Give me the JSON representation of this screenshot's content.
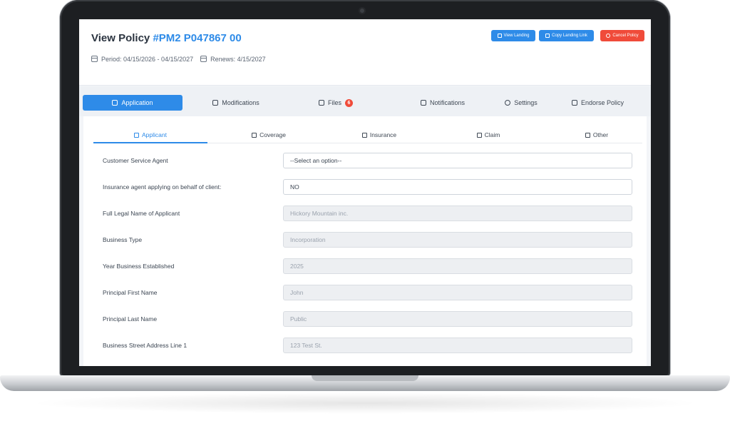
{
  "header": {
    "title_prefix": "View Policy ",
    "policy_number": "#PM2 P047867 00",
    "period": "Period: 04/15/2026 - 04/15/2027",
    "renews": "Renews: 4/15/2027",
    "buttons": {
      "view_landing": "View Landing",
      "copy_landing_link": "Copy Landing Link",
      "cancel_policy": "Cancel Policy"
    }
  },
  "main_tabs": [
    {
      "label": "Application",
      "icon": "document-icon",
      "active": true
    },
    {
      "label": "Modifications",
      "icon": "layers-icon"
    },
    {
      "label": "Files",
      "icon": "folder-icon",
      "badge": "6"
    },
    {
      "label": "Notifications",
      "icon": "external-link-icon"
    },
    {
      "label": "Settings",
      "icon": "gear-icon"
    },
    {
      "label": "Endorse Policy",
      "icon": "folder-plus-icon"
    }
  ],
  "sub_tabs": [
    {
      "label": "Applicant",
      "icon": "list-icon",
      "active": true
    },
    {
      "label": "Coverage",
      "icon": "book-icon"
    },
    {
      "label": "Insurance",
      "icon": "table-icon"
    },
    {
      "label": "Claim",
      "icon": "download-icon"
    },
    {
      "label": "Other",
      "icon": "box-icon"
    }
  ],
  "form": [
    {
      "label": "Customer Service Agent",
      "value": "--Select an option--",
      "readonly": false
    },
    {
      "label": "Insurance agent applying on behalf of client:",
      "value": "NO",
      "readonly": false
    },
    {
      "label": "Full Legal Name of Applicant",
      "value": "Hickory Mountain inc.",
      "readonly": true
    },
    {
      "label": "Business Type",
      "value": "Incorporation",
      "readonly": true
    },
    {
      "label": "Year Business Established",
      "value": "2025",
      "readonly": true
    },
    {
      "label": "Principal First Name",
      "value": "John",
      "readonly": true
    },
    {
      "label": "Principal Last Name",
      "value": "Public",
      "readonly": true
    },
    {
      "label": "Business Street Address Line 1",
      "value": "123 Test St.",
      "readonly": true
    }
  ],
  "colors": {
    "accent": "#2e8be8",
    "danger": "#f04b3a"
  }
}
